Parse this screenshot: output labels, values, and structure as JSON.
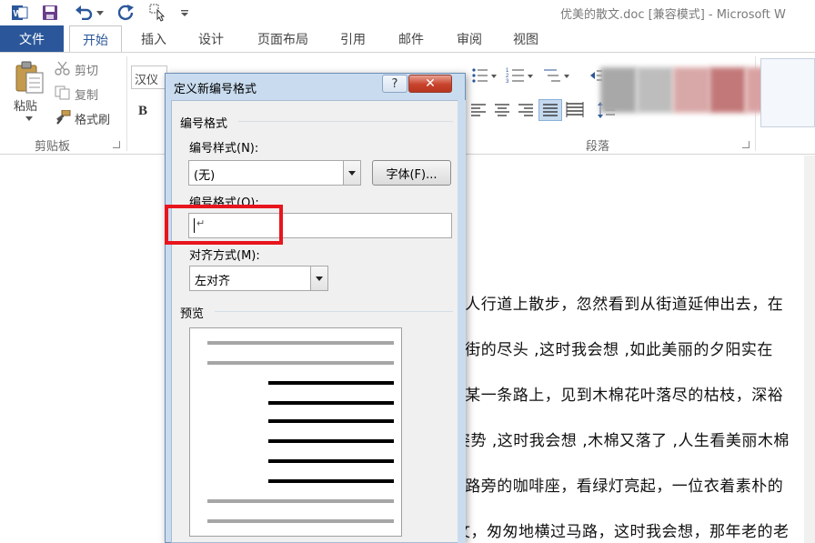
{
  "window": {
    "title": "优美的散文.doc [兼容模式] - Microsoft W"
  },
  "tabs": {
    "file": "文件",
    "items": [
      "开始",
      "插入",
      "设计",
      "页面布局",
      "引用",
      "邮件",
      "审阅",
      "视图"
    ]
  },
  "ribbon": {
    "clipboard": {
      "paste": "粘贴",
      "cut": "剪切",
      "copy": "复制",
      "format_painter": "格式刷",
      "group_label": "剪贴板"
    },
    "font": {
      "font_name": "汉仪",
      "bold": "B"
    },
    "paragraph": {
      "group_label": "段落"
    }
  },
  "dialog": {
    "title": "定义新编号格式",
    "help": "?",
    "close": "✕",
    "group_number_format": "编号格式",
    "number_style_label": "编号样式(N):",
    "number_style_value": "(无)",
    "font_button": "字体(F)...",
    "number_format_label": "编号格式(O):",
    "number_format_value": "↵",
    "alignment_label": "对齐方式(M):",
    "alignment_value": "左对齐",
    "preview_label": "预览"
  },
  "document": {
    "lines": [
      "E人行道上散步，忽然看到从街道延伸出去，在",
      "E街的尽头 ,这时我会想 ,如此美丽的夕阳实在",
      "E某一条路上，见到木棉花叶落尽的枯枝，深裕",
      "姿势 ,这时我会想 ,木棉又落了 ,人生看美丽木棉",
      "E路旁的咖啡座，看绿灯亮起，一位衣着素朴的",
      "文，匆匆地横过马路，这时我会想，那年老的老"
    ]
  },
  "colors": {
    "brand": "#2b579a",
    "highlight": "#e8151d",
    "dialog_frame": "#c9dcef"
  }
}
